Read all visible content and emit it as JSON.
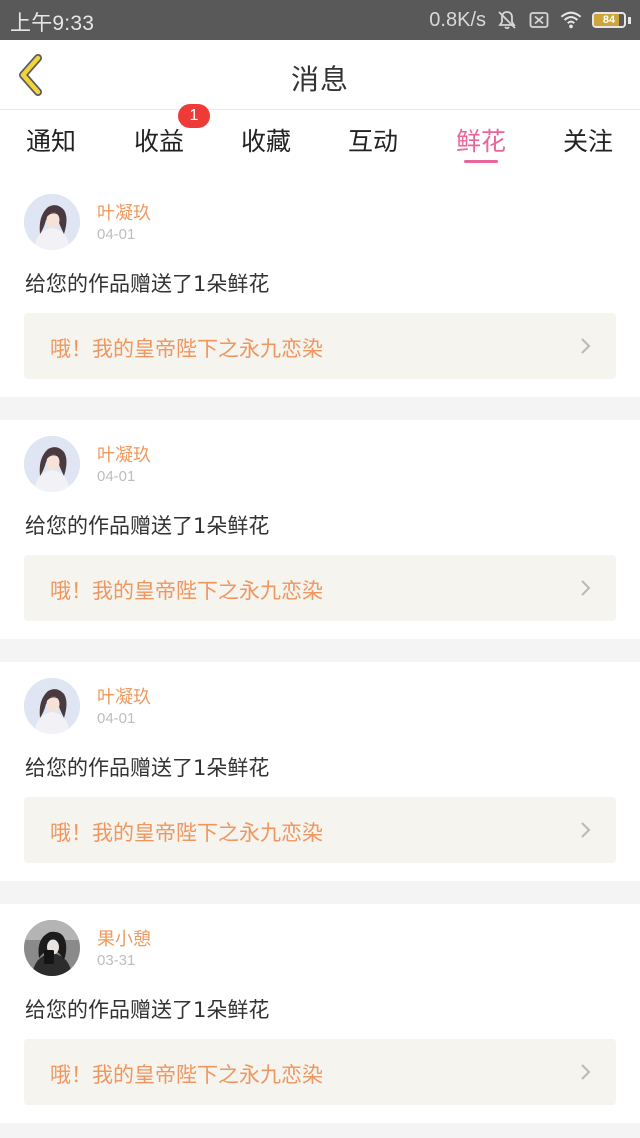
{
  "status_bar": {
    "time": "上午9:33",
    "net_speed": "0.8K/s",
    "battery_level": "84",
    "battery_percent": 84,
    "icons": [
      "bell-off-icon",
      "sim-off-icon",
      "wifi-icon",
      "battery-icon"
    ]
  },
  "header": {
    "title": "消息",
    "back_icon": "chevron-left-icon"
  },
  "tabs": [
    {
      "label": "通知"
    },
    {
      "label": "收益",
      "badge": "1"
    },
    {
      "label": "收藏"
    },
    {
      "label": "互动"
    },
    {
      "label": "鲜花",
      "active": true
    },
    {
      "label": "关注"
    }
  ],
  "messages": [
    {
      "user": "叶凝玖",
      "date": "04-01",
      "text": "给您的作品赠送了1朵鲜花",
      "work": "哦！我的皇帝陛下之永九恋染",
      "avatar": "avatar-girl-light"
    },
    {
      "user": "叶凝玖",
      "date": "04-01",
      "text": "给您的作品赠送了1朵鲜花",
      "work": "哦！我的皇帝陛下之永九恋染",
      "avatar": "avatar-girl-light"
    },
    {
      "user": "叶凝玖",
      "date": "04-01",
      "text": "给您的作品赠送了1朵鲜花",
      "work": "哦！我的皇帝陛下之永九恋染",
      "avatar": "avatar-girl-light"
    },
    {
      "user": "果小憩",
      "date": "03-31",
      "text": "给您的作品赠送了1朵鲜花",
      "work": "哦！我的皇帝陛下之永九恋染",
      "avatar": "avatar-girl-dark"
    }
  ],
  "colors": {
    "accent": "#e8669a",
    "username": "#f09a5f",
    "badge": "#ef3b38",
    "back_arrow": "#f2d43a",
    "link_bg": "#f5f4ee"
  }
}
